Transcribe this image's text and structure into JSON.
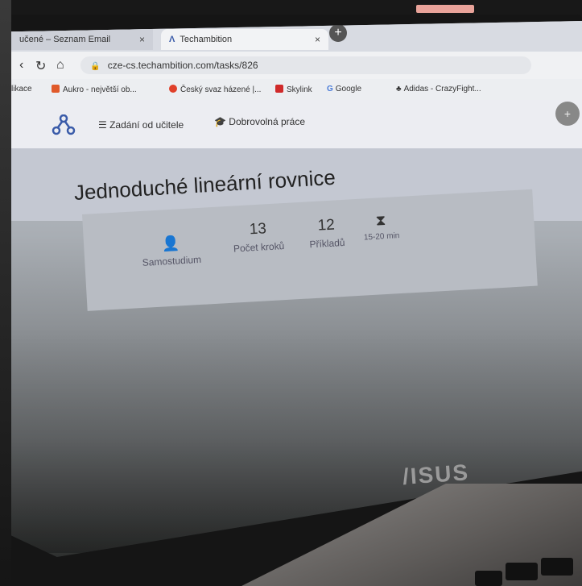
{
  "browser": {
    "tabs": [
      {
        "label": "učené – Seznam Email",
        "close": "×"
      },
      {
        "label": "Techambition",
        "close": "×"
      }
    ],
    "new_tab": "+",
    "url": "cze-cs.techambition.com/tasks/826",
    "bookmarks": [
      {
        "label": "likace",
        "color": "#888888"
      },
      {
        "label": "Aukro - největší ob...",
        "color": "#e05a2a"
      },
      {
        "label": "Český svaz házené |...",
        "color": "#e0402a"
      },
      {
        "label": "Skylink",
        "color": "#d02a2a"
      },
      {
        "label": "Google",
        "color": "#4a7bd8"
      },
      {
        "label": "Adidas - CrazyFight...",
        "color": "#333333"
      }
    ]
  },
  "app": {
    "nav": [
      {
        "label": "Zadání od učitele",
        "icon": "list-icon"
      },
      {
        "label": "Dobrovolná práce",
        "icon": "graduation-cap-icon"
      }
    ],
    "title": "Jednoduché lineární rovnice",
    "stats": [
      {
        "value": "",
        "label": "Samostudium",
        "icon": "person-icon"
      },
      {
        "value": "13",
        "label": "Počet kroků"
      },
      {
        "value": "12",
        "label": "Příkladů"
      },
      {
        "value": "",
        "label": "15-20 min",
        "icon": "hourglass-icon"
      }
    ]
  },
  "laptop": {
    "brand": "/ISUS"
  },
  "colors": {
    "accent": "#3a5ba9",
    "tab_active": "#f2f3f5"
  }
}
